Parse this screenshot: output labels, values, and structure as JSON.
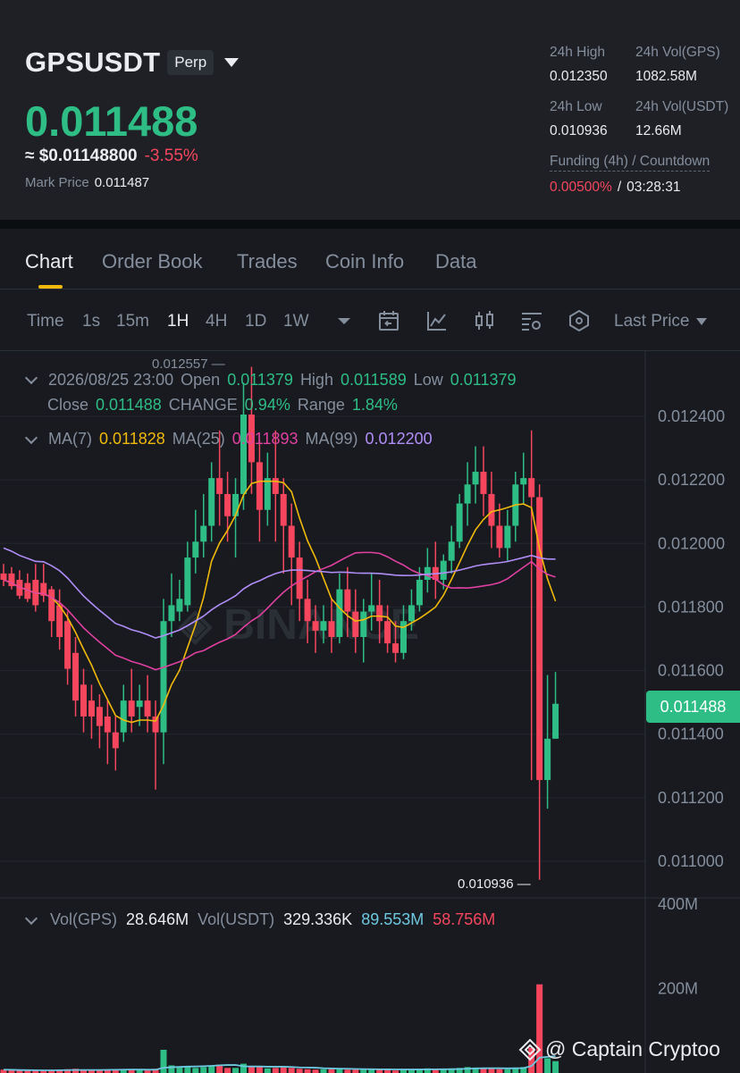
{
  "header": {
    "symbol": "GPSUSDT",
    "badge": "Perp",
    "last_price": "0.011488",
    "usd_price": "≈ $0.01148800",
    "change_pct": "-3.55%",
    "mark_label": "Mark Price",
    "mark_value": "0.011487",
    "stats": {
      "high_label": "24h High",
      "high_value": "0.012350",
      "vol_gps_label": "24h Vol(GPS)",
      "vol_gps_value": "1082.58M",
      "low_label": "24h Low",
      "low_value": "0.010936",
      "vol_usdt_label": "24h Vol(USDT)",
      "vol_usdt_value": "12.66M"
    },
    "funding_label": "Funding (4h) / Countdown",
    "funding_rate": "0.00500%",
    "funding_sep": "/",
    "countdown": "03:28:31"
  },
  "tabs": [
    {
      "label": "Chart",
      "active": true
    },
    {
      "label": "Order Book"
    },
    {
      "label": "Trades"
    },
    {
      "label": "Coin Info"
    },
    {
      "label": "Data"
    }
  ],
  "toolbar": {
    "timeframes": [
      "Time",
      "1s",
      "15m",
      "1H",
      "4H",
      "1D",
      "1W"
    ],
    "active_timeframe": "1H",
    "price_type": "Last Price",
    "icons": [
      "dropdown-icon",
      "calendar-icon",
      "indicator-icon",
      "candle-type-icon",
      "settings-icon",
      "layers-icon"
    ]
  },
  "ohlc": {
    "date": "2026/08/25 23:00",
    "open_label": "Open",
    "open": "0.011379",
    "high_label": "High",
    "high": "0.011589",
    "low_label": "Low",
    "low": "0.011379",
    "close_label": "Close",
    "close": "0.011488",
    "change_label": "CHANGE",
    "change": "0.94%",
    "range_label": "Range",
    "range": "1.84%"
  },
  "ma": {
    "ma7_label": "MA(7)",
    "ma7": "0.011828",
    "ma25_label": "MA(25)",
    "ma25": "0.011893",
    "ma99_label": "MA(99)",
    "ma99": "0.012200"
  },
  "volume": {
    "label1": "Vol(GPS)",
    "value1": "28.646M",
    "label2": "Vol(USDT)",
    "value2": "329.336K",
    "ma1": "89.553M",
    "ma2": "58.756M"
  },
  "current_price_tag": "0.011488",
  "watermark": "@ Captain Cryptoo",
  "colors": {
    "up": "#2ebd85",
    "down": "#f6465d",
    "ma7": "#f0b90b",
    "ma25": "#e040a0",
    "ma99": "#b18df7",
    "accent": "#f0b90b"
  },
  "chart_data": {
    "type": "candlestick",
    "y_ticks": [
      "0.012400",
      "0.012200",
      "0.012000",
      "0.011800",
      "0.011600",
      "0.011400",
      "0.011200",
      "0.011000"
    ],
    "ylim": [
      0.0109,
      0.01252
    ],
    "high_marker": "0.012557",
    "low_marker": "0.010936",
    "vol_ticks": [
      "400M",
      "200M"
    ],
    "vol_ylim": [
      0,
      400
    ],
    "candles": [
      [
        0.0119,
        0.01193,
        0.01188,
        0.01186
      ],
      [
        0.0119,
        0.01192,
        0.01186,
        0.01185
      ],
      [
        0.01188,
        0.01191,
        0.01183,
        0.01182
      ],
      [
        0.01187,
        0.0119,
        0.01182,
        0.01181
      ],
      [
        0.01188,
        0.01193,
        0.0118,
        0.01178
      ],
      [
        0.01187,
        0.01193,
        0.01183,
        0.01181
      ],
      [
        0.01185,
        0.01186,
        0.01175,
        0.0117
      ],
      [
        0.0118,
        0.01185,
        0.0117,
        0.01166
      ],
      [
        0.01175,
        0.01178,
        0.0116,
        0.01155
      ],
      [
        0.01165,
        0.0117,
        0.0115,
        0.01145
      ],
      [
        0.01155,
        0.0116,
        0.01145,
        0.0114
      ],
      [
        0.0115,
        0.01155,
        0.01145,
        0.01138
      ],
      [
        0.01148,
        0.01152,
        0.01142,
        0.01135
      ],
      [
        0.01145,
        0.0115,
        0.0114,
        0.0113
      ],
      [
        0.0114,
        0.01145,
        0.01135,
        0.01128
      ],
      [
        0.0114,
        0.01155,
        0.0115,
        0.01137
      ],
      [
        0.0115,
        0.0116,
        0.01145,
        0.0114
      ],
      [
        0.01148,
        0.01155,
        0.0115,
        0.01142
      ],
      [
        0.0115,
        0.01158,
        0.01145,
        0.0114
      ],
      [
        0.01145,
        0.0115,
        0.0114,
        0.01122
      ],
      [
        0.0114,
        0.01182,
        0.01175,
        0.0113
      ],
      [
        0.01175,
        0.0119,
        0.0118,
        0.0117
      ],
      [
        0.01178,
        0.01188,
        0.01182,
        0.01175
      ],
      [
        0.0118,
        0.012,
        0.01195,
        0.01178
      ],
      [
        0.01195,
        0.0121,
        0.012,
        0.0119
      ],
      [
        0.012,
        0.01215,
        0.01205,
        0.01195
      ],
      [
        0.01205,
        0.01225,
        0.0122,
        0.012
      ],
      [
        0.0122,
        0.01235,
        0.01215,
        0.01205
      ],
      [
        0.01215,
        0.01222,
        0.01208,
        0.012
      ],
      [
        0.01208,
        0.0122,
        0.01215,
        0.01195
      ],
      [
        0.01215,
        0.0125,
        0.0124,
        0.0121
      ],
      [
        0.0124,
        0.01255,
        0.01225,
        0.01215
      ],
      [
        0.01225,
        0.01232,
        0.0121,
        0.012
      ],
      [
        0.0121,
        0.01228,
        0.0122,
        0.01205
      ],
      [
        0.0122,
        0.01235,
        0.01215,
        0.012
      ],
      [
        0.01215,
        0.0122,
        0.01205,
        0.0119
      ],
      [
        0.01205,
        0.01212,
        0.01195,
        0.0118
      ],
      [
        0.01195,
        0.012,
        0.01182,
        0.01175
      ],
      [
        0.01182,
        0.01188,
        0.01175,
        0.01168
      ],
      [
        0.01175,
        0.0118,
        0.01172,
        0.01165
      ],
      [
        0.01172,
        0.0118,
        0.01175,
        0.01168
      ],
      [
        0.01175,
        0.01182,
        0.0117,
        0.01165
      ],
      [
        0.0117,
        0.0119,
        0.01185,
        0.01168
      ],
      [
        0.01185,
        0.01192,
        0.01178,
        0.0117
      ],
      [
        0.01178,
        0.01185,
        0.0117,
        0.01165
      ],
      [
        0.0117,
        0.01182,
        0.01178,
        0.01162
      ],
      [
        0.01178,
        0.0119,
        0.0118,
        0.01172
      ],
      [
        0.0118,
        0.01188,
        0.01175,
        0.01168
      ],
      [
        0.01175,
        0.0118,
        0.01168,
        0.01165
      ],
      [
        0.01168,
        0.01175,
        0.01165,
        0.01162
      ],
      [
        0.01165,
        0.0118,
        0.01175,
        0.01163
      ],
      [
        0.01175,
        0.01185,
        0.0118,
        0.01172
      ],
      [
        0.0118,
        0.01192,
        0.01188,
        0.01178
      ],
      [
        0.01188,
        0.01198,
        0.01192,
        0.01184
      ],
      [
        0.01192,
        0.012,
        0.01188,
        0.01182
      ],
      [
        0.01188,
        0.01196,
        0.01194,
        0.01185
      ],
      [
        0.01194,
        0.01205,
        0.012,
        0.0119
      ],
      [
        0.012,
        0.01215,
        0.01212,
        0.01198
      ],
      [
        0.01212,
        0.01225,
        0.01218,
        0.01205
      ],
      [
        0.01218,
        0.0123,
        0.01222,
        0.01212
      ],
      [
        0.01222,
        0.0123,
        0.01215,
        0.01208
      ],
      [
        0.01215,
        0.01222,
        0.01205,
        0.01198
      ],
      [
        0.01205,
        0.01212,
        0.01198,
        0.01195
      ],
      [
        0.01198,
        0.0121,
        0.01205,
        0.01194
      ],
      [
        0.01205,
        0.01222,
        0.01218,
        0.012
      ],
      [
        0.01218,
        0.01228,
        0.0122,
        0.01212
      ],
      [
        0.0122,
        0.01235,
        0.01214,
        0.01125
      ],
      [
        0.01214,
        0.01218,
        0.01125,
        0.010936
      ],
      [
        0.01125,
        0.01158,
        0.01138,
        0.01116
      ],
      [
        0.01138,
        0.01159,
        0.01149,
        0.01138
      ]
    ],
    "volumes": [
      8,
      7,
      6,
      6,
      6,
      5,
      7,
      8,
      9,
      10,
      8,
      7,
      6,
      8,
      9,
      8,
      9,
      7,
      6,
      10,
      55,
      18,
      14,
      16,
      12,
      14,
      18,
      20,
      12,
      12,
      22,
      15,
      14,
      11,
      12,
      13,
      12,
      10,
      9,
      8,
      9,
      9,
      10,
      8,
      8,
      9,
      10,
      8,
      7,
      6,
      8,
      9,
      10,
      11,
      10,
      10,
      11,
      12,
      14,
      13,
      12,
      10,
      9,
      9,
      12,
      14,
      60,
      210,
      35,
      28
    ]
  }
}
